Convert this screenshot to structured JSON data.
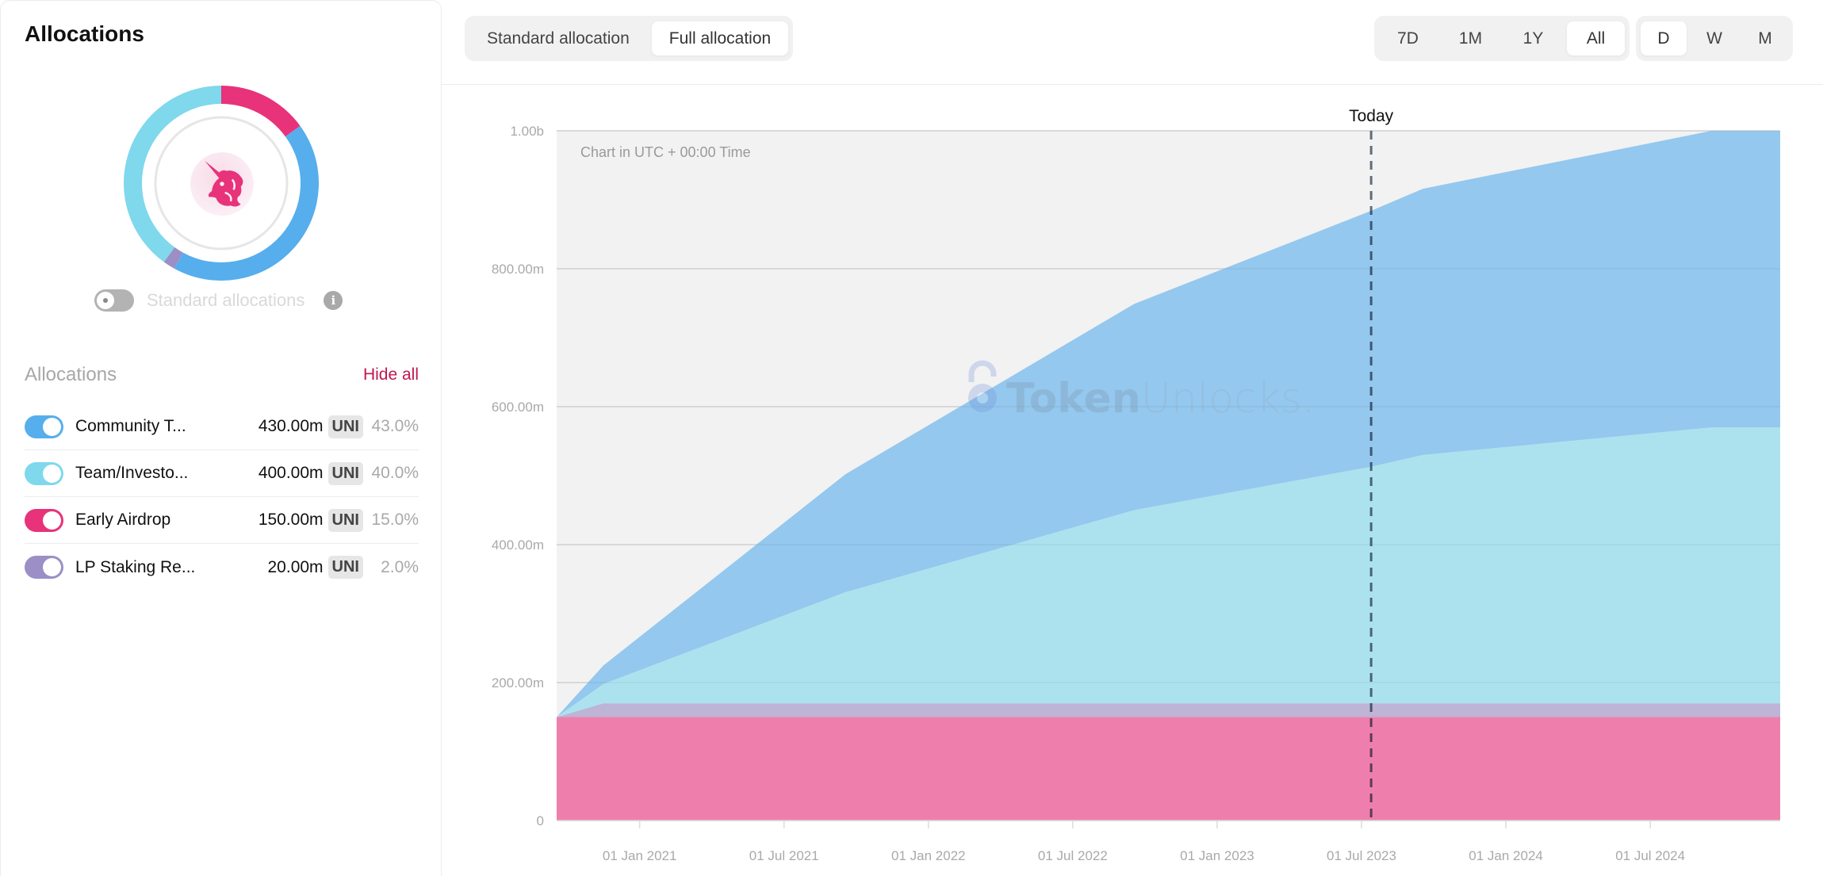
{
  "left_panel": {
    "title": "Allocations",
    "logo": "uniswap-unicorn-logo",
    "standard_toggle": {
      "label": "Standard allocations",
      "on": false,
      "info_icon": "info-icon"
    },
    "list_header": "Allocations",
    "hide_all_label": "Hide all",
    "hide_all_color": "#c0174f",
    "items": [
      {
        "name": "Community T...",
        "amount": "430.00m",
        "unit": "UNI",
        "percent": "43.0%",
        "share": 43.0,
        "color": "#56aeec",
        "enabled": true
      },
      {
        "name": "Team/Investo...",
        "amount": "400.00m",
        "unit": "UNI",
        "percent": "40.0%",
        "share": 40.0,
        "color": "#7fd8ec",
        "enabled": true
      },
      {
        "name": "Early Airdrop",
        "amount": "150.00m",
        "unit": "UNI",
        "percent": "15.0%",
        "share": 15.0,
        "color": "#e8327a",
        "enabled": true
      },
      {
        "name": "LP Staking Re...",
        "amount": "20.00m",
        "unit": "UNI",
        "percent": "2.0%",
        "share": 2.0,
        "color": "#9b8fc6",
        "enabled": true
      }
    ]
  },
  "toolbar": {
    "allocation_modes": [
      {
        "label": "Standard allocation",
        "active": false
      },
      {
        "label": "Full allocation",
        "active": true
      }
    ],
    "ranges": [
      {
        "label": "7D",
        "active": false
      },
      {
        "label": "1M",
        "active": false
      },
      {
        "label": "1Y",
        "active": false
      },
      {
        "label": "All",
        "active": true
      }
    ],
    "granularity": [
      {
        "label": "D",
        "active": true
      },
      {
        "label": "W",
        "active": false
      },
      {
        "label": "M",
        "active": false
      }
    ]
  },
  "chart_data": {
    "type": "area",
    "stacked": true,
    "title": "",
    "note": "Chart in UTC + 00:00 Time",
    "watermark": {
      "bold": "Token",
      "light": "Unlocks."
    },
    "today_label": "Today",
    "today_month": 34.4,
    "x_unit": "months since 01 Sep 2020",
    "x_range": [
      0.55,
      51.4
    ],
    "ylim": [
      0,
      1000
    ],
    "y_unit": "millions UNI",
    "y_ticks": [
      {
        "value": 0,
        "label": "0"
      },
      {
        "value": 200,
        "label": "200.00m"
      },
      {
        "value": 400,
        "label": "400.00m"
      },
      {
        "value": 600,
        "label": "600.00m"
      },
      {
        "value": 800,
        "label": "800.00m"
      },
      {
        "value": 1000,
        "label": "1.00b"
      }
    ],
    "x_ticks": [
      {
        "month": 4,
        "label": "01 Jan 2021"
      },
      {
        "month": 10,
        "label": "01 Jul 2021"
      },
      {
        "month": 16,
        "label": "01 Jan 2022"
      },
      {
        "month": 22,
        "label": "01 Jul 2022"
      },
      {
        "month": 28,
        "label": "01 Jan 2023"
      },
      {
        "month": 34,
        "label": "01 Jul 2023"
      },
      {
        "month": 40,
        "label": "01 Jan 2024"
      },
      {
        "month": 46,
        "label": "01 Jul 2024"
      }
    ],
    "grid": true,
    "legend": "left-panel",
    "x": [
      0.55,
      2.5,
      12.55,
      24.55,
      34.4,
      36.55,
      48.55,
      51.4
    ],
    "series": [
      {
        "name": "Early Airdrop",
        "color": "#ee7fac",
        "values": [
          150,
          150,
          150,
          150,
          150,
          150,
          150,
          150
        ]
      },
      {
        "name": "LP Staking Rewards",
        "color": "#bdb4d6",
        "values": [
          0,
          20,
          20,
          20,
          20,
          20,
          20,
          20
        ]
      },
      {
        "name": "Team/Investors",
        "color": "#ace2ee",
        "values": [
          0,
          28,
          161,
          280,
          343,
          360,
          400,
          400
        ]
      },
      {
        "name": "Community Treasury",
        "color": "#94c8ee",
        "values": [
          0,
          27,
          171,
          299,
          371,
          386,
          430,
          430
        ]
      }
    ]
  }
}
